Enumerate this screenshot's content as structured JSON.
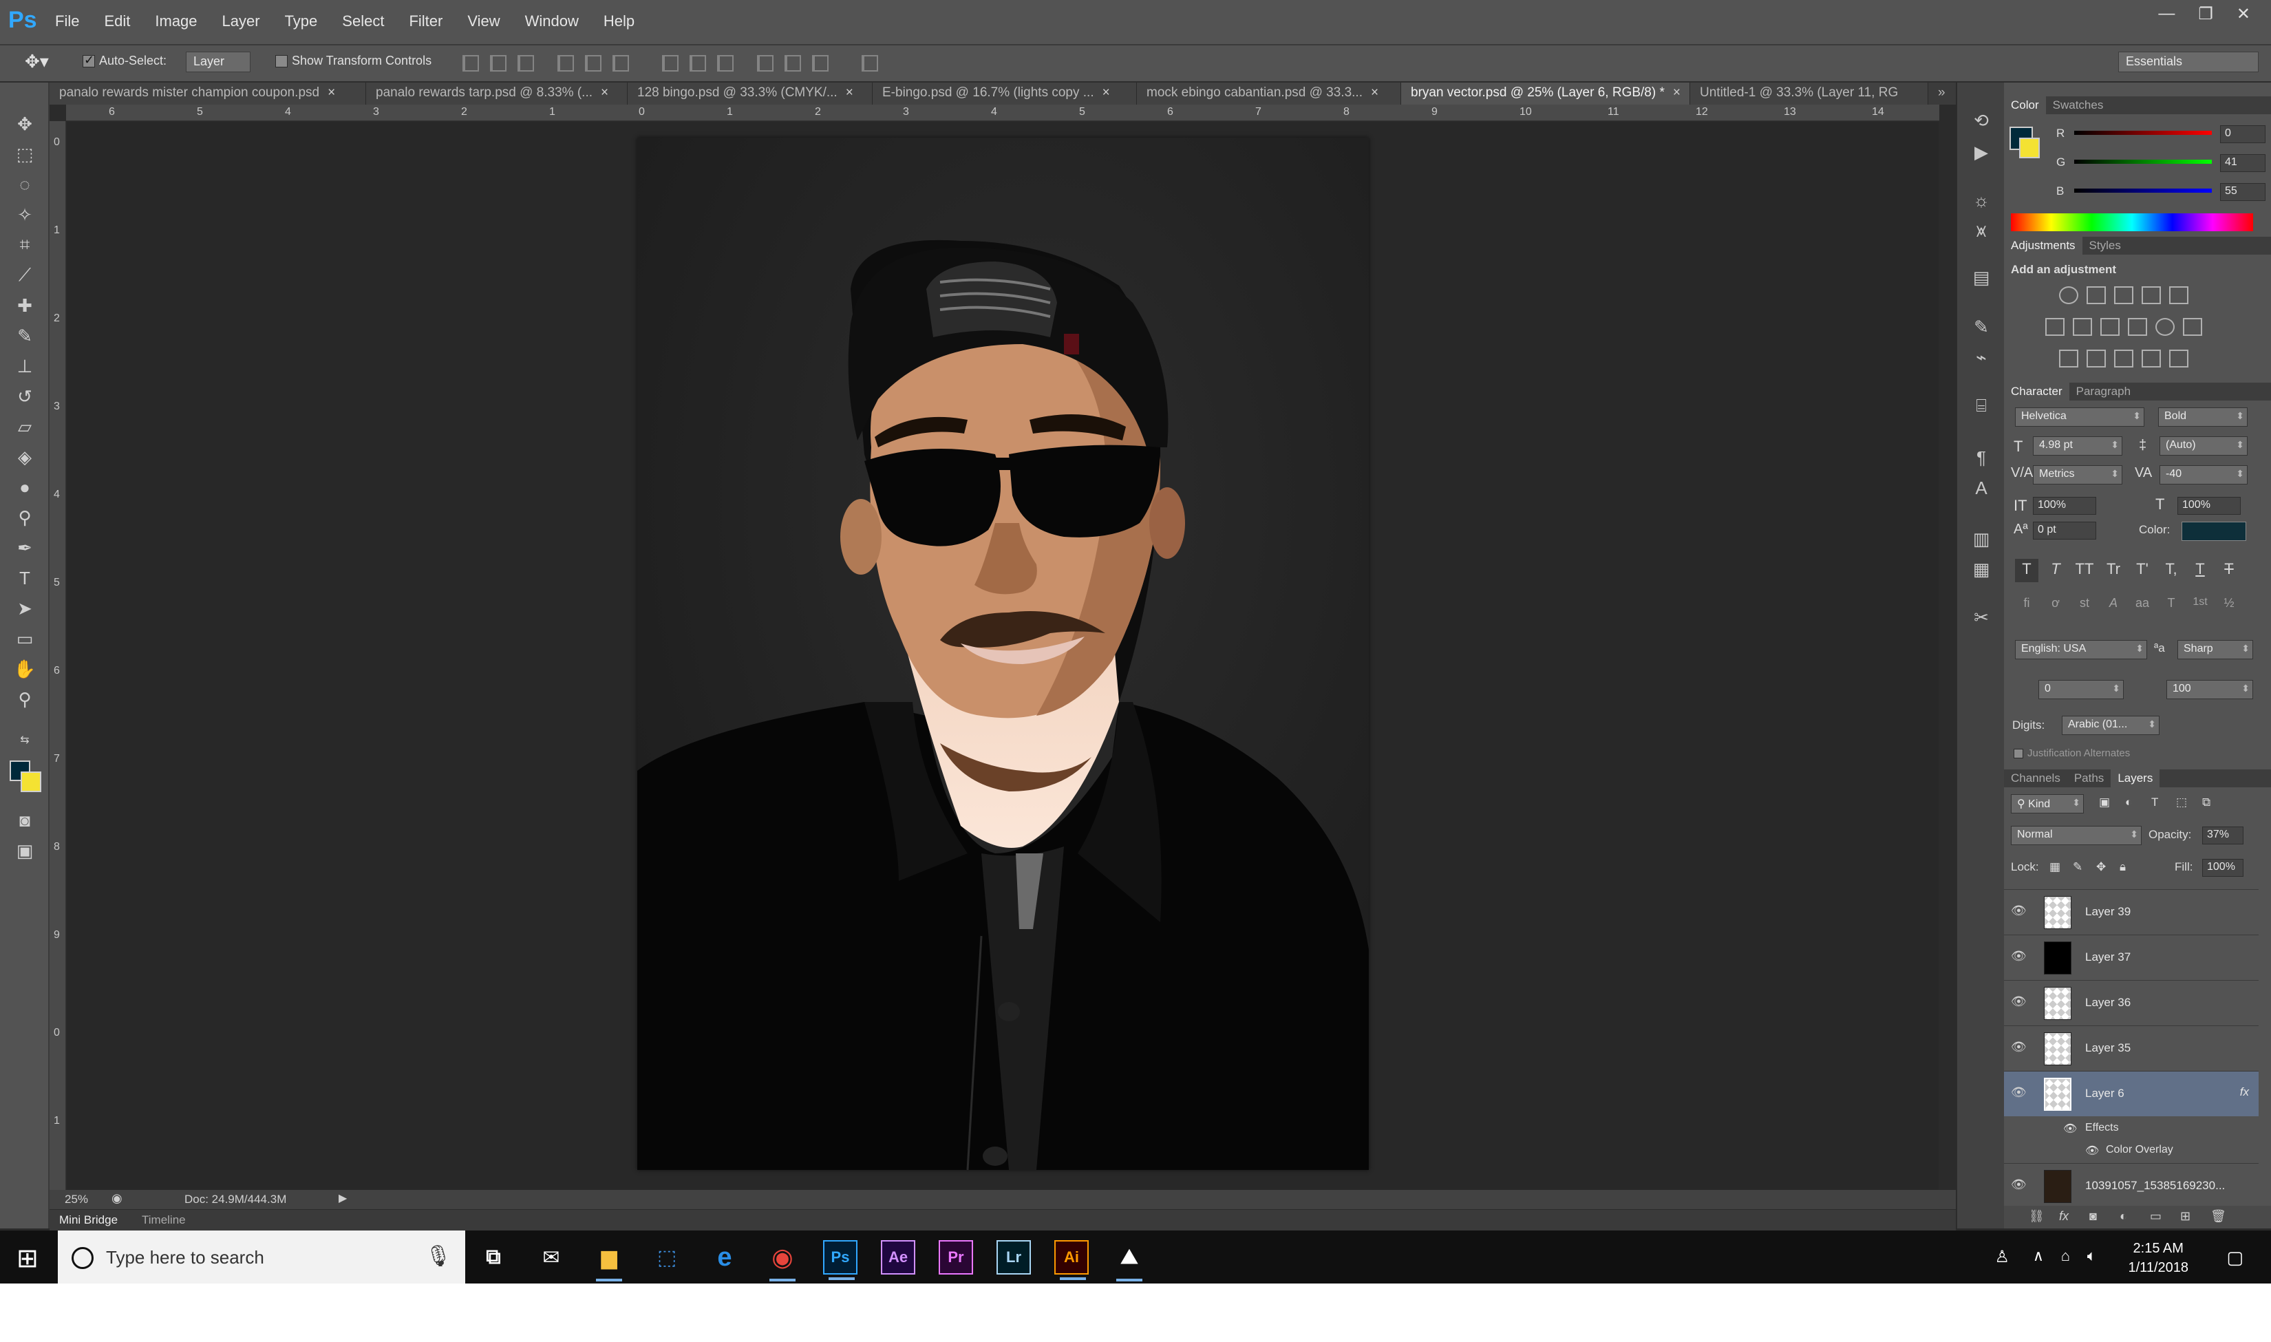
{
  "app": {
    "logo": "Ps"
  },
  "menu": [
    "File",
    "Edit",
    "Image",
    "Layer",
    "Type",
    "Select",
    "Filter",
    "View",
    "Window",
    "Help"
  ],
  "window_controls": {
    "minimize": "—",
    "restore": "❐",
    "close": "✕"
  },
  "options_bar": {
    "auto_select_label": "Auto-Select:",
    "auto_select_checked": true,
    "auto_select_target": "Layer",
    "show_transform_label": "Show Transform Controls",
    "workspace": "Essentials"
  },
  "tabs": [
    {
      "label": "panalo rewards mister champion coupon.psd",
      "close": "×"
    },
    {
      "label": "panalo rewards tarp.psd @ 8.33% (...",
      "close": "×"
    },
    {
      "label": "128 bingo.psd @ 33.3% (CMYK/...",
      "close": "×"
    },
    {
      "label": "E-bingo.psd @ 16.7% (lights copy ...",
      "close": "×"
    },
    {
      "label": "mock ebingo cabantian.psd @ 33.3...",
      "close": "×"
    },
    {
      "label": "bryan vector.psd @ 25% (Layer 6, RGB/8) *",
      "close": "×",
      "active": true
    },
    {
      "label": "Untitled-1 @ 33.3% (Layer 11, RG",
      "close": ""
    }
  ],
  "tabs_overflow": "»",
  "ruler_top": [
    "6",
    "5",
    "4",
    "3",
    "2",
    "1",
    "0",
    "1",
    "2",
    "3",
    "4",
    "5",
    "6",
    "7",
    "8",
    "9",
    "10",
    "11",
    "12",
    "13",
    "14"
  ],
  "ruler_left": [
    "0",
    "1",
    "2",
    "3",
    "4",
    "5",
    "6",
    "7",
    "8",
    "9",
    "0",
    "1"
  ],
  "status": {
    "zoom": "25%",
    "doc": "Doc: 24.9M/444.3M"
  },
  "bottom_tabs": [
    "Mini Bridge",
    "Timeline"
  ],
  "color_panel": {
    "tabs": [
      "Color",
      "Swatches"
    ],
    "r_label": "R",
    "r": "0",
    "g_label": "G",
    "g": "41",
    "b_label": "B",
    "b": "55",
    "foreground": "#00293a",
    "background": "#f4e232"
  },
  "adjustments_panel": {
    "tabs": [
      "Adjustments",
      "Styles"
    ],
    "heading": "Add an adjustment"
  },
  "character_panel": {
    "tabs": [
      "Character",
      "Paragraph"
    ],
    "font_family": "Helvetica",
    "font_style": "Bold",
    "size": "4.98 pt",
    "leading": "(Auto)",
    "kerning": "Metrics",
    "tracking": "-40",
    "vertical_scale": "100%",
    "horizontal_scale": "100%",
    "baseline": "0 pt",
    "color_label": "Color:",
    "color": "#0e2f3a",
    "style_buttons": [
      "T",
      "T",
      "TT",
      "Tr",
      "T'",
      "T,",
      "T",
      "T"
    ],
    "opentype_buttons": [
      "fi",
      "ơ",
      "st",
      "A",
      "aa",
      "T",
      "1st",
      "½"
    ],
    "language": "English: USA",
    "aa_label": "ªa",
    "antialias": "Sharp",
    "field_a": "0",
    "field_b": "100",
    "digits_label": "Digits:",
    "digits": "Arabic (01...",
    "justification_label": "Justification Alternates"
  },
  "layers_panel": {
    "tabs": [
      "Channels",
      "Paths",
      "Layers"
    ],
    "kind": "Kind",
    "blend_mode": "Normal",
    "opacity_label": "Opacity:",
    "opacity": "37%",
    "lock_label": "Lock:",
    "fill_label": "Fill:",
    "fill": "100%",
    "layers": [
      {
        "name": "Layer 39"
      },
      {
        "name": "Layer 37"
      },
      {
        "name": "Layer 36"
      },
      {
        "name": "Layer 35"
      },
      {
        "name": "Layer 6",
        "selected": true,
        "fx": "fx"
      },
      {
        "name": "10391057_15385169230..."
      }
    ],
    "effects_label": "Effects",
    "color_overlay_label": "Color Overlay"
  },
  "taskbar": {
    "search_placeholder": "Type here to search",
    "apps": [
      "Ps",
      "Ae",
      "Pr",
      "Lr",
      "Ai"
    ],
    "time": "2:15 AM",
    "date": "1/11/2018"
  }
}
